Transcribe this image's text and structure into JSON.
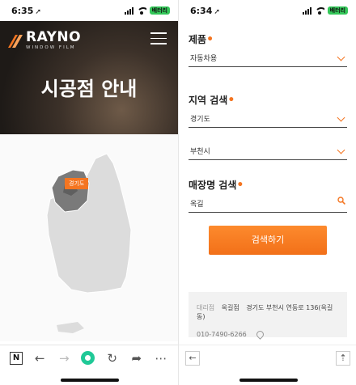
{
  "left": {
    "status": {
      "time": "6:35",
      "battery": "배터리"
    },
    "brand": {
      "name": "RAYNO",
      "tagline": "WINDOW FILM"
    },
    "hero_title": "시공점 안내",
    "map": {
      "region_label": "경기도",
      "highlight_color": "#7a7a7a",
      "marker_color": "#f47521"
    },
    "nav": {
      "n_label": "N"
    }
  },
  "right": {
    "status": {
      "time": "6:34",
      "battery": "배터리"
    },
    "product": {
      "label": "제품",
      "value": "자동차용"
    },
    "region": {
      "label": "지역 검색",
      "province": "경기도",
      "city": "부천시"
    },
    "store": {
      "label": "매장명 검색",
      "value": "옥길"
    },
    "search_button": "검색하기",
    "result": {
      "type": "대리점",
      "name": "옥길점",
      "address": "경기도 부천시 연동로 136(옥길동)",
      "phone": "010-7490-6266"
    }
  }
}
